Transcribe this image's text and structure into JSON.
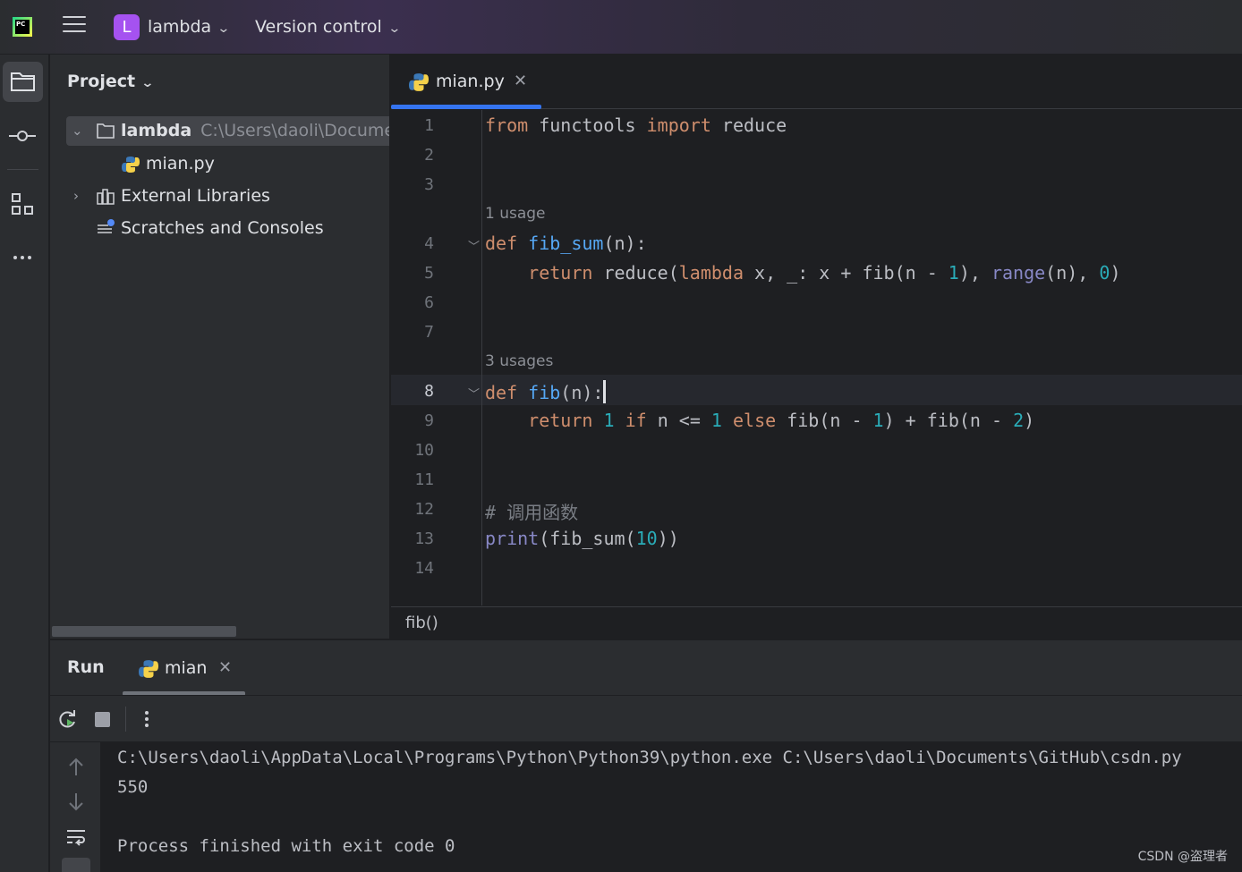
{
  "titlebar": {
    "project_initial": "L",
    "project_name": "lambda",
    "vcs_label": "Version control",
    "project_color": "#a552f0"
  },
  "sidebar_tools": [
    "project-icon",
    "commit-icon",
    "structure-icon",
    "more-icon"
  ],
  "project_panel": {
    "title": "Project",
    "tree": {
      "root_name": "lambda",
      "root_path": "C:\\Users\\daoli\\Documents",
      "file": "mian.py",
      "external": "External Libraries",
      "scratches": "Scratches and Consoles"
    }
  },
  "editor": {
    "tab_label": "mian.py",
    "line_numbers": [
      "1",
      "2",
      "3",
      "4",
      "5",
      "6",
      "7",
      "8",
      "9",
      "10",
      "11",
      "12",
      "13",
      "14"
    ],
    "current_line": "8",
    "hints": {
      "fib_sum": "1 usage",
      "fib": "3 usages"
    },
    "breadcrumb": "fib()"
  },
  "run_panel": {
    "title": "Run",
    "tab_label": "mian",
    "console": [
      "C:\\Users\\daoli\\AppData\\Local\\Programs\\Python\\Python39\\python.exe C:\\Users\\daoli\\Documents\\GitHub\\csdn.py",
      "550",
      "",
      "Process finished with exit code 0"
    ]
  },
  "watermark": "CSDN @盗理者",
  "colors": {
    "accent": "#3574f0",
    "keyword": "#cf8e6d",
    "function": "#56a8f5",
    "number": "#2aacb8",
    "builtin": "#8888c6"
  }
}
